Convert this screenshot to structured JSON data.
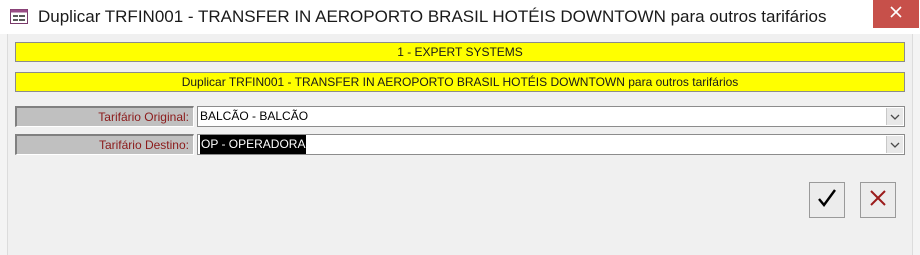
{
  "window": {
    "title": "Duplicar TRFIN001 - TRANSFER IN AEROPORTO BRASIL HOTÉIS DOWNTOWN para outros tarifários"
  },
  "banners": {
    "company": "1 - EXPERT SYSTEMS",
    "description": "Duplicar TRFIN001 - TRANSFER IN AEROPORTO BRASIL HOTÉIS DOWNTOWN para outros tarifários"
  },
  "form": {
    "origin": {
      "label": "Tarifário Original:",
      "value": "BALCÃO - BALCÃO"
    },
    "destination": {
      "label": "Tarifário Destino:",
      "value": "OP - OPERADORA"
    }
  },
  "colors": {
    "banner": "#ffff00",
    "close_button": "#c7504a",
    "label_text": "#8b1a1a",
    "cancel_icon": "#9b1c1c"
  },
  "icons": {
    "window": "form-window-icon",
    "close": "close-icon",
    "dropdown": "chevron-down-icon",
    "ok": "checkmark-icon",
    "cancel": "x-icon"
  }
}
